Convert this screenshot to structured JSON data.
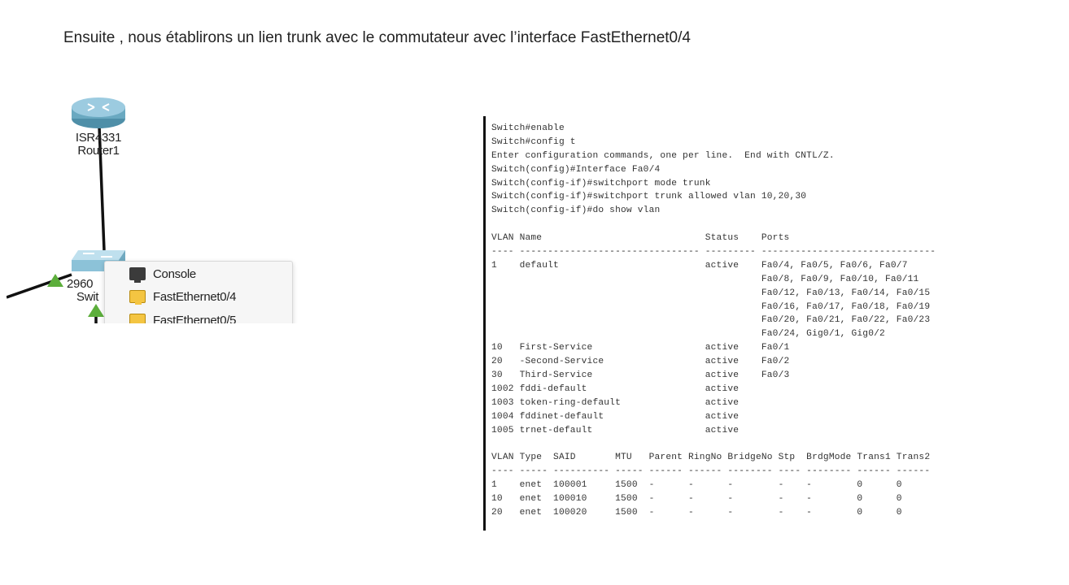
{
  "intro_text": "Ensuite , nous établirons un lien trunk avec le commutateur avec l’interface FastEthernet0/4",
  "topology": {
    "router": {
      "model_label": "ISR4331",
      "name_label": "Router1"
    },
    "switch": {
      "model_label": "2960",
      "name_label": "Swit"
    },
    "port_menu": {
      "items": [
        {
          "label": "Console",
          "icon": "console-port-icon"
        },
        {
          "label": "FastEthernet0/4",
          "icon": "ethernet-port-icon"
        },
        {
          "label": "FastEthernet0/5",
          "icon": "ethernet-port-icon"
        }
      ]
    },
    "colors": {
      "link_up": "#5cae3b",
      "port_yellow": "#f4c542",
      "port_dark": "#3b3b3b"
    }
  },
  "terminal": {
    "lines": [
      "Switch#enable",
      "Switch#config t",
      "Enter configuration commands, one per line.  End with CNTL/Z.",
      "Switch(config)#Interface Fa0/4",
      "Switch(config-if)#switchport mode trunk",
      "Switch(config-if)#switchport trunk allowed vlan 10,20,30",
      "Switch(config-if)#do show vlan",
      "",
      "VLAN Name                             Status    Ports",
      "---- -------------------------------- --------- -------------------------------",
      "1    default                          active    Fa0/4, Fa0/5, Fa0/6, Fa0/7",
      "                                                Fa0/8, Fa0/9, Fa0/10, Fa0/11",
      "                                                Fa0/12, Fa0/13, Fa0/14, Fa0/15",
      "                                                Fa0/16, Fa0/17, Fa0/18, Fa0/19",
      "                                                Fa0/20, Fa0/21, Fa0/22, Fa0/23",
      "                                                Fa0/24, Gig0/1, Gig0/2",
      "10   First-Service                    active    Fa0/1",
      "20   -Second-Service                  active    Fa0/2",
      "30   Third-Service                    active    Fa0/3",
      "1002 fddi-default                     active",
      "1003 token-ring-default               active",
      "1004 fddinet-default                  active",
      "1005 trnet-default                    active",
      "",
      "VLAN Type  SAID       MTU   Parent RingNo BridgeNo Stp  BrdgMode Trans1 Trans2",
      "---- ----- ---------- ----- ------ ------ -------- ---- -------- ------ ------",
      "1    enet  100001     1500  -      -      -        -    -        0      0",
      "10   enet  100010     1500  -      -      -        -    -        0      0",
      "20   enet  100020     1500  -      -      -        -    -        0      0"
    ]
  }
}
